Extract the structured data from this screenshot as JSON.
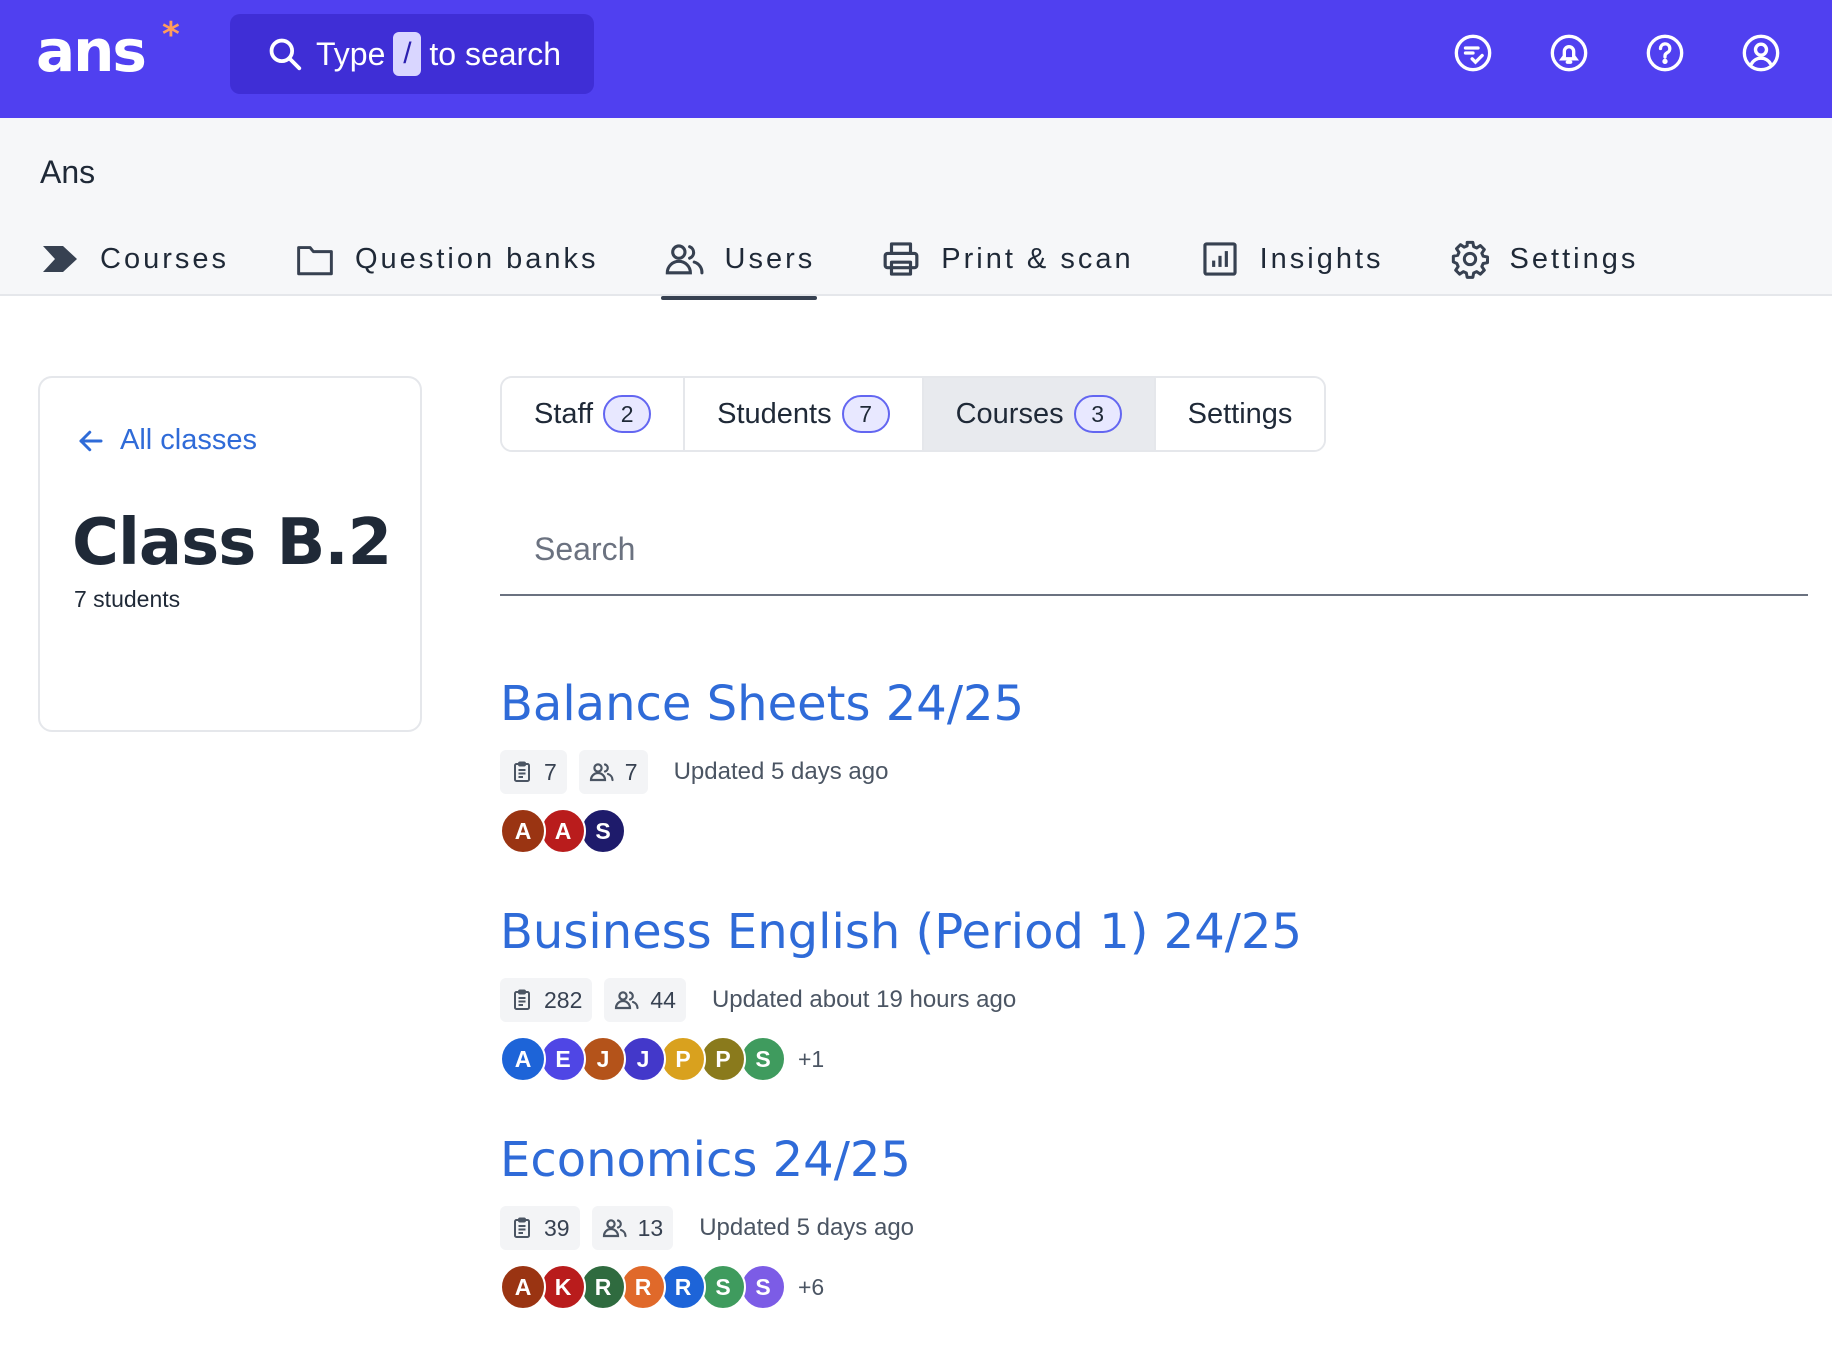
{
  "topbar": {
    "logo": "ans",
    "logo_mark": "*",
    "search": {
      "before": "Type",
      "key": "/",
      "after": "to search"
    },
    "icons": [
      "checklist-icon",
      "bell-icon",
      "help-icon",
      "account-icon"
    ]
  },
  "subheader": {
    "org_name": "Ans",
    "nav": [
      {
        "label": "Courses",
        "icon": "chevron-course-icon"
      },
      {
        "label": "Question banks",
        "icon": "folder-icon"
      },
      {
        "label": "Users",
        "icon": "users-icon",
        "active": true
      },
      {
        "label": "Print & scan",
        "icon": "printer-icon"
      },
      {
        "label": "Insights",
        "icon": "chart-icon"
      },
      {
        "label": "Settings",
        "icon": "gear-icon"
      }
    ]
  },
  "class_card": {
    "back_label": "All classes",
    "title": "Class B.2",
    "subtitle": "7 students"
  },
  "tabs": [
    {
      "label": "Staff",
      "count": "2"
    },
    {
      "label": "Students",
      "count": "7"
    },
    {
      "label": "Courses",
      "count": "3",
      "active": true
    },
    {
      "label": "Settings",
      "count": null
    }
  ],
  "search": {
    "placeholder": "Search"
  },
  "courses": [
    {
      "title": "Balance Sheets 24/25",
      "assignments": "7",
      "users": "7",
      "updated": "Updated 5 days ago",
      "avatars": [
        {
          "letter": "A",
          "color": "#9a3412"
        },
        {
          "letter": "A",
          "color": "#b91c1c"
        },
        {
          "letter": "S",
          "color": "#1e1b6b"
        }
      ],
      "more": ""
    },
    {
      "title": "Business English (Period 1) 24/25",
      "assignments": "282",
      "users": "44",
      "updated": "Updated about 19 hours ago",
      "avatars": [
        {
          "letter": "A",
          "color": "#1d64d8"
        },
        {
          "letter": "E",
          "color": "#4f46e5"
        },
        {
          "letter": "J",
          "color": "#b4531a"
        },
        {
          "letter": "J",
          "color": "#4338ca"
        },
        {
          "letter": "P",
          "color": "#d9a11e"
        },
        {
          "letter": "P",
          "color": "#8a7a1c"
        },
        {
          "letter": "S",
          "color": "#3f9b5e"
        }
      ],
      "more": "+1"
    },
    {
      "title": "Economics 24/25",
      "assignments": "39",
      "users": "13",
      "updated": "Updated 5 days ago",
      "avatars": [
        {
          "letter": "A",
          "color": "#9a3412"
        },
        {
          "letter": "K",
          "color": "#b91c1c"
        },
        {
          "letter": "R",
          "color": "#2f6b3f"
        },
        {
          "letter": "R",
          "color": "#e0692a"
        },
        {
          "letter": "R",
          "color": "#1d64d8"
        },
        {
          "letter": "S",
          "color": "#3f9b5e"
        },
        {
          "letter": "S",
          "color": "#7c5ce6"
        }
      ],
      "more": "+6"
    }
  ],
  "colors": {
    "brand": "#5040f0",
    "link": "#2f6bd8",
    "accent_logo": "#ff9d5c"
  }
}
